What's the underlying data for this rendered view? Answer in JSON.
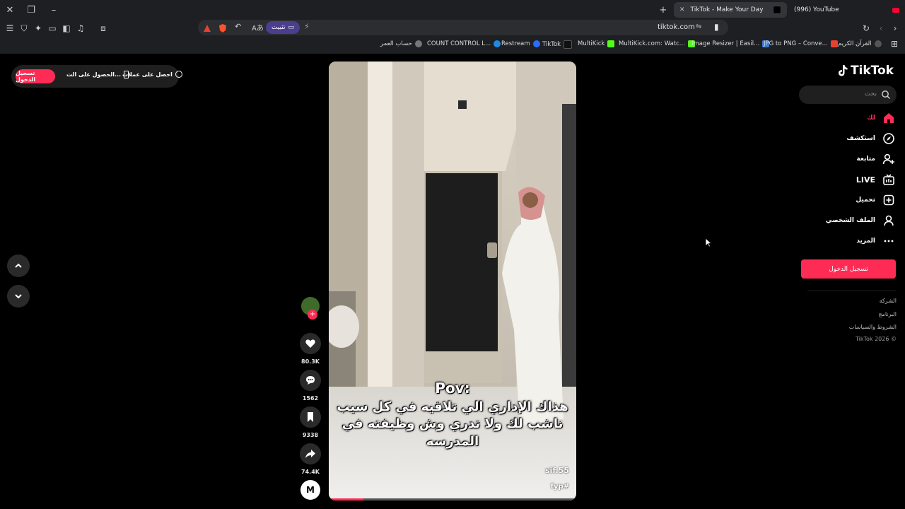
{
  "browser": {
    "tabs": [
      {
        "label": "TikTok - Make Your Day",
        "active": true
      },
      {
        "label": "(996) YouTube",
        "active": false
      }
    ],
    "url": "tiktok.com",
    "install_label": "تثبيت"
  },
  "bookmarks": [
    {
      "label": "القرآن الكريم",
      "color": "#555555"
    },
    {
      "label": "JPG to PNG – Conve...",
      "color": "#e8412f"
    },
    {
      "label": "Image Resizer | Easil...",
      "color": "#3a7bd5"
    },
    {
      "label": "MultiKick.com: Watc...",
      "color": "#53fc18"
    },
    {
      "label": "MultiKick",
      "color": "#53fc18"
    },
    {
      "label": "TikTok",
      "color": "#111111"
    },
    {
      "label": "Restream",
      "color": "#2b6cff"
    },
    {
      "label": "COUNT CONTROL L...",
      "color": "#1e88e5"
    },
    {
      "label": "حساب العمر",
      "color": "#777777"
    }
  ],
  "promo": {
    "login": "تسجيل الدخول",
    "get_app": "الحصول على الت...",
    "get_coins": "احصل على عملات"
  },
  "video": {
    "caption_title": "Pov:",
    "caption_lines": [
      "هذاك الإداري الي تلاقيه في كل سيب",
      "ناشب لك ولا تدري وش وظيفته في",
      "المدرسه"
    ],
    "username": "sif.55",
    "hashtag": "fyp#",
    "progress": 0.14
  },
  "actions": {
    "likes": "80.3K",
    "comments": "1562",
    "saves": "9338",
    "shares": "74.4K"
  },
  "sidebar": {
    "logo": "TikTok",
    "search_placeholder": "بحث",
    "items": [
      {
        "label": "لك",
        "icon": "home-icon"
      },
      {
        "label": "استكشف",
        "icon": "compass-icon"
      },
      {
        "label": "متابعة",
        "icon": "user-plus-icon"
      },
      {
        "label": "LIVE",
        "icon": "live-icon"
      },
      {
        "label": "تحميل",
        "icon": "upload-icon"
      },
      {
        "label": "الملف الشخصي",
        "icon": "profile-icon"
      },
      {
        "label": "المزيد",
        "icon": "more-icon"
      }
    ],
    "login": "تسجيل الدخول",
    "footer": [
      "الشركة",
      "البرنامج",
      "الشروط والسياسات",
      "TikTok 2026 ©"
    ],
    "accent": "#fe2c55"
  }
}
